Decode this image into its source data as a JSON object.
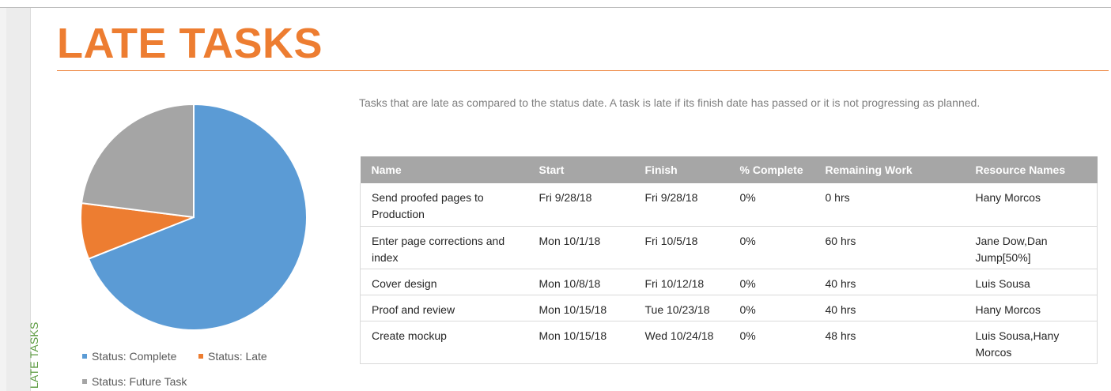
{
  "side_tab": {
    "label": "LATE TASKS"
  },
  "report": {
    "title": "LATE TASKS",
    "description": "Tasks that are late as compared to the status date. A task is late if its finish date has passed or it is not progressing as planned."
  },
  "chart_data": {
    "type": "pie",
    "title": "",
    "series": [
      {
        "name": "Status: Complete",
        "value": 69,
        "color": "#5b9bd5"
      },
      {
        "name": "Status: Late",
        "value": 8,
        "color": "#ed7d31"
      },
      {
        "name": "Status: Future Task",
        "value": 23,
        "color": "#a5a5a5"
      }
    ],
    "start_angle_deg": 0,
    "direction": "clockwise",
    "legend_position": "bottom"
  },
  "legend": {
    "items": [
      {
        "label": "Status: Complete",
        "color": "#5b9bd5"
      },
      {
        "label": "Status: Late",
        "color": "#ed7d31"
      },
      {
        "label": "Status: Future Task",
        "color": "#a5a5a5"
      }
    ]
  },
  "table": {
    "headers": [
      "Name",
      "Start",
      "Finish",
      "% Complete",
      "Remaining Work",
      "Resource Names"
    ],
    "rows": [
      [
        "Send proofed pages to Production",
        "Fri 9/28/18",
        "Fri 9/28/18",
        "0%",
        "0 hrs",
        "Hany Morcos"
      ],
      [
        "Enter page corrections and index",
        "Mon 10/1/18",
        "Fri 10/5/18",
        "0%",
        "60 hrs",
        "Jane Dow,Dan Jump[50%]"
      ],
      [
        "Cover design",
        "Mon 10/8/18",
        "Fri 10/12/18",
        "0%",
        "40 hrs",
        "Luis Sousa"
      ],
      [
        "Proof and review",
        "Mon 10/15/18",
        "Tue 10/23/18",
        "0%",
        "40 hrs",
        "Hany Morcos"
      ],
      [
        "Create mockup",
        "Mon 10/15/18",
        "Wed 10/24/18",
        "0%",
        "48 hrs",
        "Luis Sousa,Hany Morcos"
      ]
    ]
  },
  "colors": {
    "accent": "#ed7d31",
    "side_tab_text": "#5a9a3e",
    "table_header": "#a6a6a6"
  }
}
